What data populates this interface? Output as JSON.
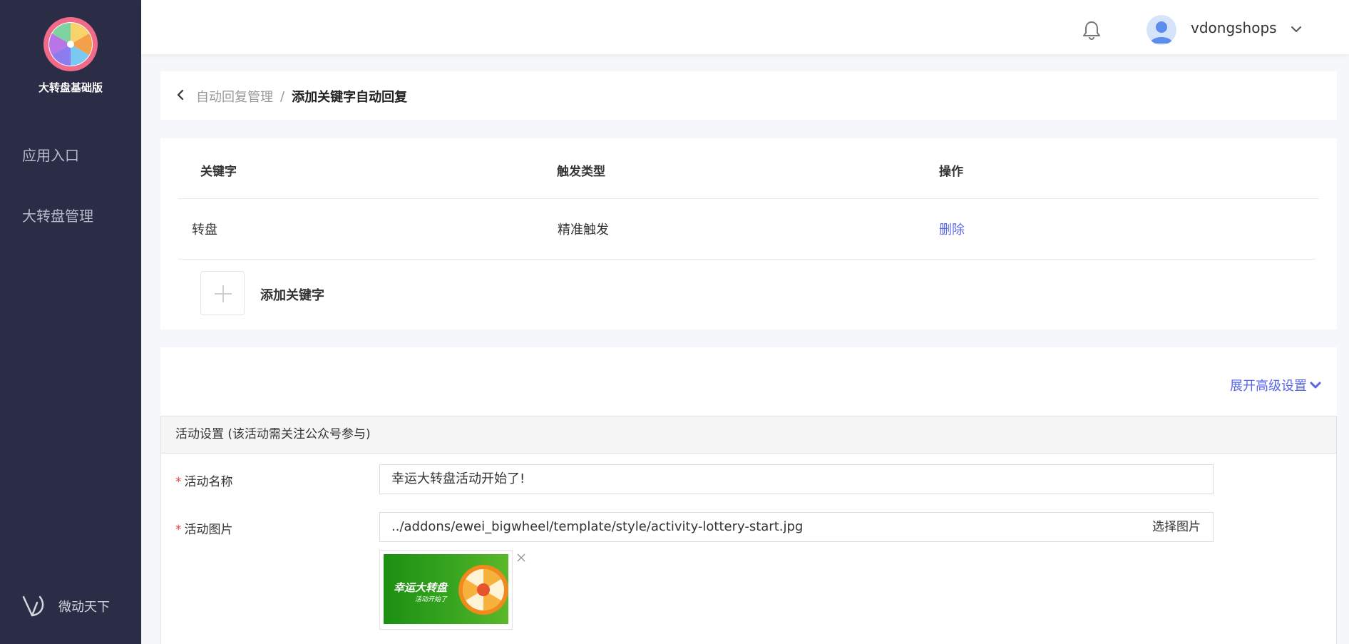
{
  "sidebar": {
    "brand_title": "大转盘基础版",
    "items": [
      {
        "label": "应用入口"
      },
      {
        "label": "大转盘管理"
      }
    ],
    "footer_label": "微动天下"
  },
  "header": {
    "username": "vdongshops"
  },
  "breadcrumb": {
    "parent": "自动回复管理",
    "separator": "/",
    "current": "添加关键字自动回复"
  },
  "keyword_table": {
    "columns": [
      "关键字",
      "触发类型",
      "操作"
    ],
    "rows": [
      {
        "keyword": "转盘",
        "trigger": "精准触发",
        "action": "删除"
      }
    ],
    "add_label": "添加关键字"
  },
  "settings": {
    "advanced_link": "展开高级设置",
    "panel_title": "活动设置 (该活动需关注公众号参与)",
    "fields": {
      "name": {
        "label": "活动名称",
        "value": "幸运大转盘活动开始了!"
      },
      "image": {
        "label": "活动图片",
        "value": "../addons/ewei_bigwheel/template/style/activity-lottery-start.jpg",
        "button": "选择图片"
      }
    },
    "thumb_title": "幸运大转盘",
    "thumb_subtitle": "活动开始了"
  },
  "colors": {
    "sidebar_bg": "#2b2d47",
    "accent_link": "#5865e8",
    "required_star": "#e23c3c"
  }
}
